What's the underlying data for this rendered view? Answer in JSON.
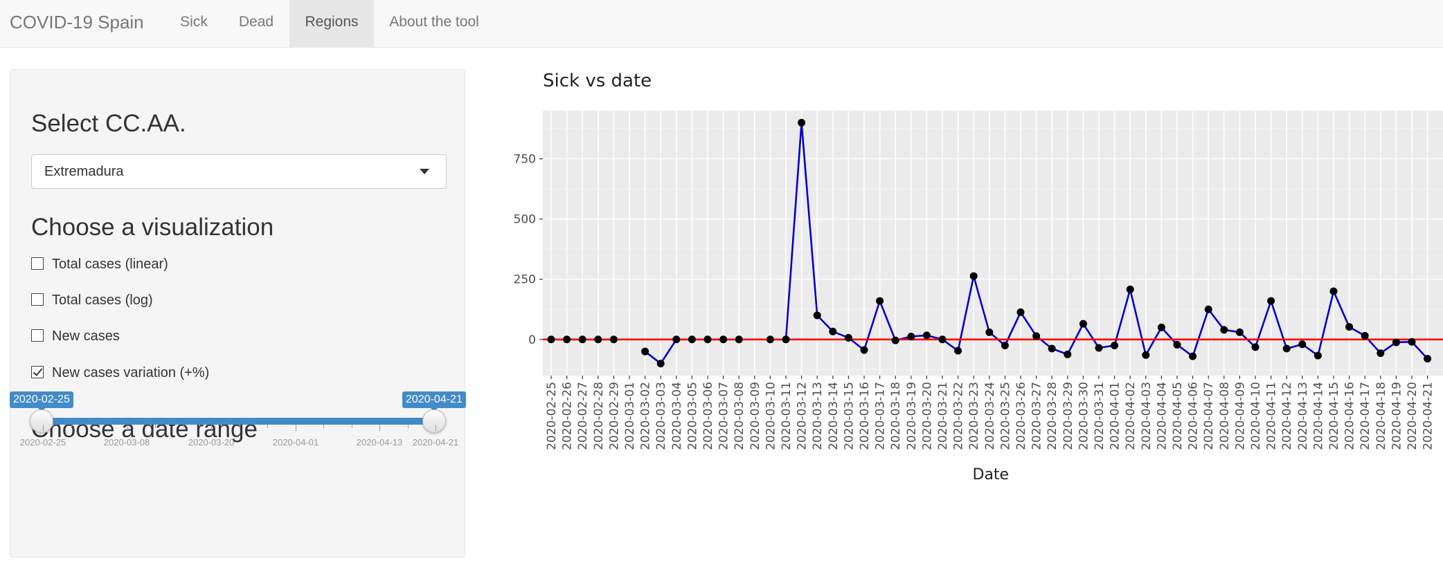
{
  "navbar": {
    "brand": "COVID-19 Spain",
    "tabs": [
      {
        "label": "Sick",
        "active": false
      },
      {
        "label": "Dead",
        "active": false
      },
      {
        "label": "Regions",
        "active": true
      },
      {
        "label": "About the tool",
        "active": false
      }
    ]
  },
  "sidebar": {
    "select_heading": "Select CC.AA.",
    "select_value": "Extremadura",
    "viz_heading": "Choose a visualization",
    "options": [
      {
        "label": "Total cases (linear)",
        "checked": false
      },
      {
        "label": "Total cases (log)",
        "checked": false
      },
      {
        "label": "New cases",
        "checked": false
      },
      {
        "label": "New cases variation (+%)",
        "checked": true
      }
    ],
    "date_heading": "Choose a date range",
    "slider": {
      "from": "2020-02-25",
      "to": "2020-04-21",
      "grid_labels": [
        "2020-02-25",
        "2020-03-08",
        "2020-03-20",
        "2020-04-01",
        "2020-04-13",
        "2020-04-21"
      ]
    }
  },
  "chart_data": {
    "type": "line",
    "title": "Sick vs date",
    "xlabel": "Date",
    "ylabel": "",
    "x": [
      "2020-02-25",
      "2020-02-26",
      "2020-02-27",
      "2020-02-28",
      "2020-02-29",
      "2020-03-01",
      "2020-03-02",
      "2020-03-03",
      "2020-03-04",
      "2020-03-05",
      "2020-03-06",
      "2020-03-07",
      "2020-03-08",
      "2020-03-09",
      "2020-03-10",
      "2020-03-11",
      "2020-03-12",
      "2020-03-13",
      "2020-03-14",
      "2020-03-15",
      "2020-03-16",
      "2020-03-17",
      "2020-03-18",
      "2020-03-19",
      "2020-03-20",
      "2020-03-21",
      "2020-03-22",
      "2020-03-23",
      "2020-03-24",
      "2020-03-25",
      "2020-03-26",
      "2020-03-27",
      "2020-03-28",
      "2020-03-29",
      "2020-03-30",
      "2020-03-31",
      "2020-04-01",
      "2020-04-02",
      "2020-04-03",
      "2020-04-04",
      "2020-04-05",
      "2020-04-06",
      "2020-04-07",
      "2020-04-08",
      "2020-04-09",
      "2020-04-10",
      "2020-04-11",
      "2020-04-12",
      "2020-04-13",
      "2020-04-14",
      "2020-04-15",
      "2020-04-16",
      "2020-04-17",
      "2020-04-18",
      "2020-04-19",
      "2020-04-20",
      "2020-04-21"
    ],
    "series": [
      {
        "values": [
          0,
          0,
          0,
          0,
          0,
          null,
          -50,
          -100,
          0,
          0,
          0,
          0,
          0,
          null,
          0,
          0,
          900,
          100,
          33,
          7,
          -44,
          160,
          -4,
          12,
          17,
          0,
          -47,
          263,
          30,
          -25,
          113,
          14,
          -38,
          -62,
          65,
          -35,
          -25,
          208,
          -65,
          50,
          -22,
          -70,
          125,
          40,
          30,
          -32,
          160,
          -38,
          -20,
          -67,
          200,
          52,
          15,
          -57,
          -12,
          -10,
          -80
        ],
        "color": "#0000cc",
        "marker_color": "#000000"
      }
    ],
    "reference_line": {
      "y": 0,
      "color": "#ff0000"
    },
    "yticks": [
      0,
      250,
      500,
      750
    ],
    "ylim": [
      -150,
      950
    ],
    "grid": true,
    "background": "#ebebeb",
    "legend": "none"
  }
}
